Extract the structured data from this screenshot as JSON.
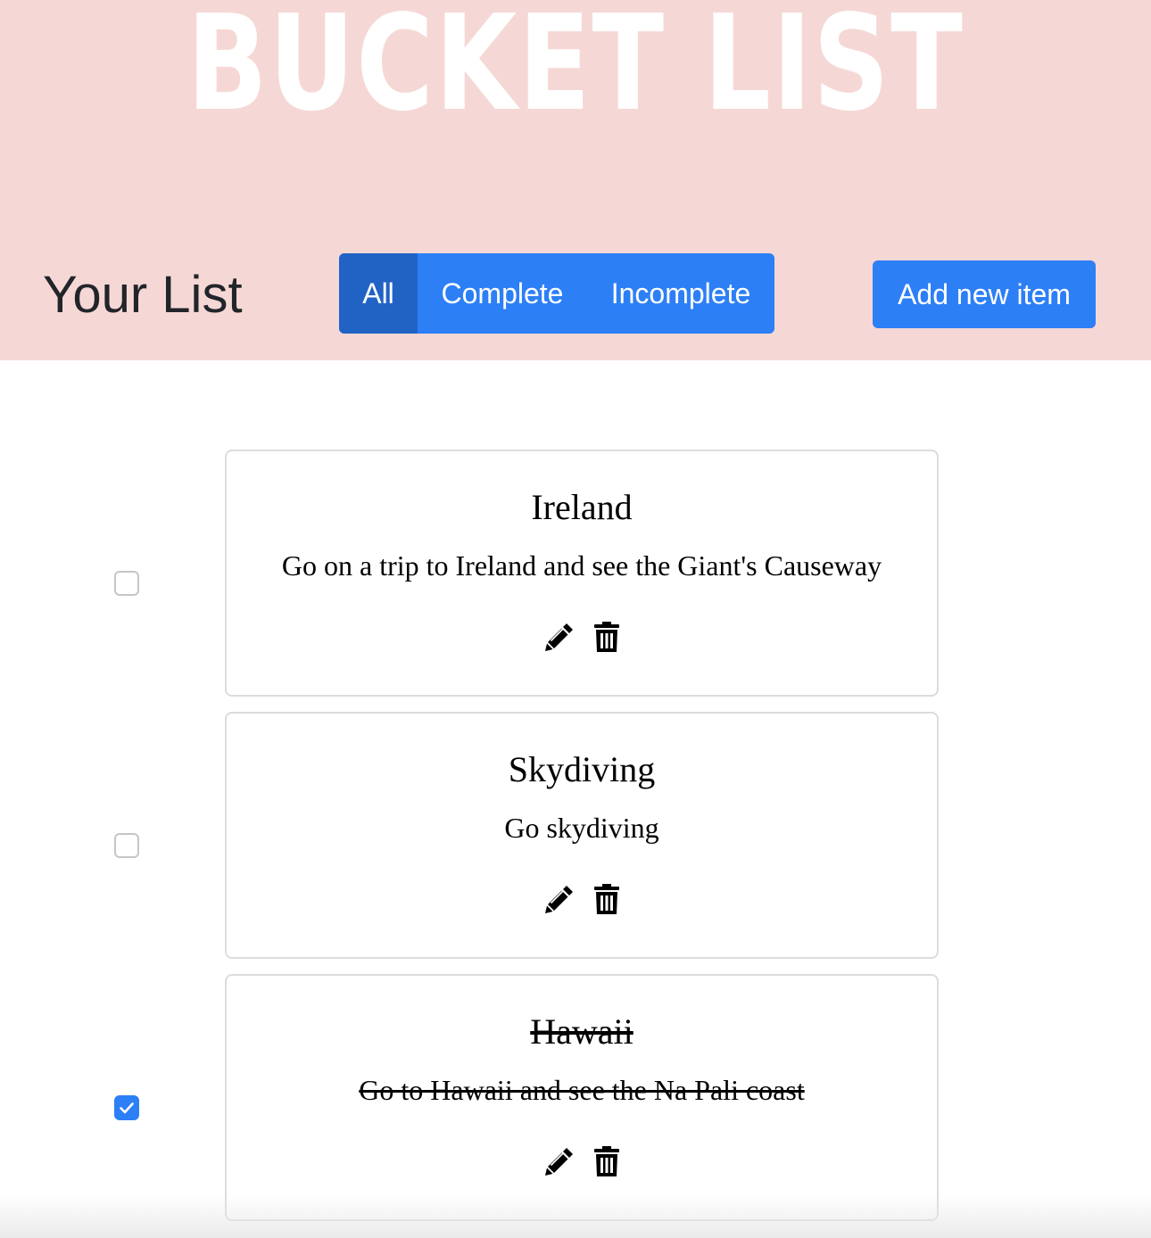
{
  "header": {
    "title": "BUCKET LIST",
    "background": "#f5d8d5",
    "list_heading": "Your List",
    "filters": [
      {
        "label": "All",
        "active": true
      },
      {
        "label": "Complete",
        "active": false
      },
      {
        "label": "Incomplete",
        "active": false
      }
    ],
    "add_label": "Add new item",
    "accent": "#2d7ff6",
    "accent_active": "#2163c4"
  },
  "items": [
    {
      "title": "Ireland",
      "description": "Go on a trip to Ireland and see the Giant's Causeway",
      "completed": false,
      "edit_icon": "pencil-icon",
      "delete_icon": "trash-icon"
    },
    {
      "title": "Skydiving",
      "description": "Go skydiving",
      "completed": false,
      "edit_icon": "pencil-icon",
      "delete_icon": "trash-icon"
    },
    {
      "title": "Hawaii",
      "description": "Go to Hawaii and see the Na Pali coast",
      "completed": true,
      "edit_icon": "pencil-icon",
      "delete_icon": "trash-icon"
    }
  ]
}
